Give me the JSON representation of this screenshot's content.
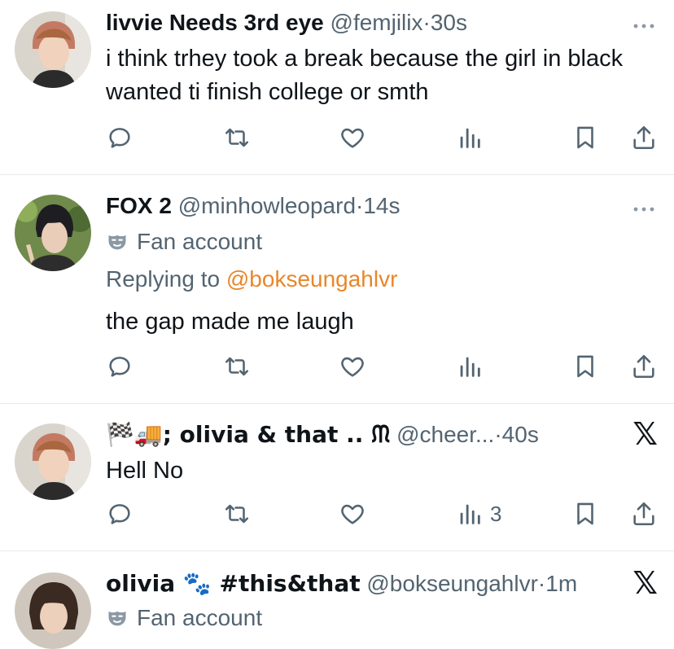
{
  "tweets": [
    {
      "name": "livvie Needs 3rd eye",
      "handle": "@femjilix",
      "time": "30s",
      "text": "i think trhey took a break because the girl in black wanted ti finish college or smth",
      "views": ""
    },
    {
      "name": "FOX 2",
      "handle": "@minhowleopard",
      "time": "14s",
      "fan_label": "Fan account",
      "replying_prefix": "Replying to",
      "replying_to": "@bokseungahlvr",
      "text": "the gap made me laugh",
      "views": ""
    },
    {
      "name": "🏁🚚; olivia & that .. ᙏ",
      "handle": "@cheer...",
      "time": "40s",
      "text": "Hell No",
      "views": "3"
    },
    {
      "name": "olivia 🐾 #this&that",
      "handle": "@bokseungahlvr",
      "time": "1m",
      "fan_label": "Fan account"
    }
  ],
  "separator": "·",
  "colors": {
    "muted": "#536471",
    "mention": "#e8872a",
    "divider": "#e6e9ec"
  },
  "icons": [
    "reply-icon",
    "retweet-icon",
    "like-icon",
    "views-icon",
    "bookmark-icon",
    "share-icon",
    "more-icon",
    "x-logo-icon",
    "mask-icon"
  ]
}
